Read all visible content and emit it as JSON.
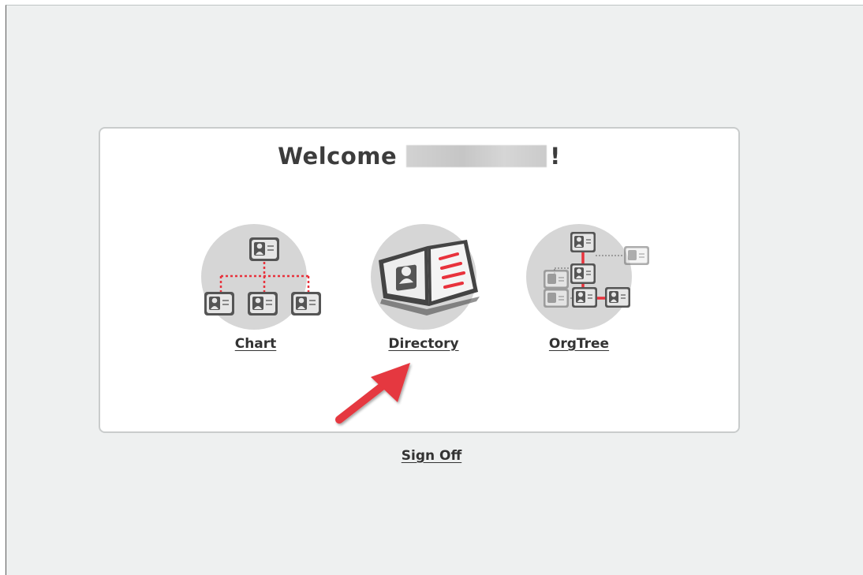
{
  "welcome": {
    "prefix": "Welcome",
    "suffix": "!"
  },
  "apps": [
    {
      "label": "Chart",
      "icon": "org-chart-icon"
    },
    {
      "label": "Directory",
      "icon": "directory-book-icon"
    },
    {
      "label": "OrgTree",
      "icon": "org-tree-icon"
    }
  ],
  "signoff": {
    "label": "Sign Off"
  },
  "colors": {
    "accent_red": "#e8323c",
    "arrow_red": "#e5393f",
    "icon_circle": "#d6d6d6",
    "page_bg": "#eef0f0",
    "panel_bg": "#ffffff",
    "text": "#333333"
  },
  "annotation": {
    "icon": "red-arrow-annotation-icon"
  }
}
